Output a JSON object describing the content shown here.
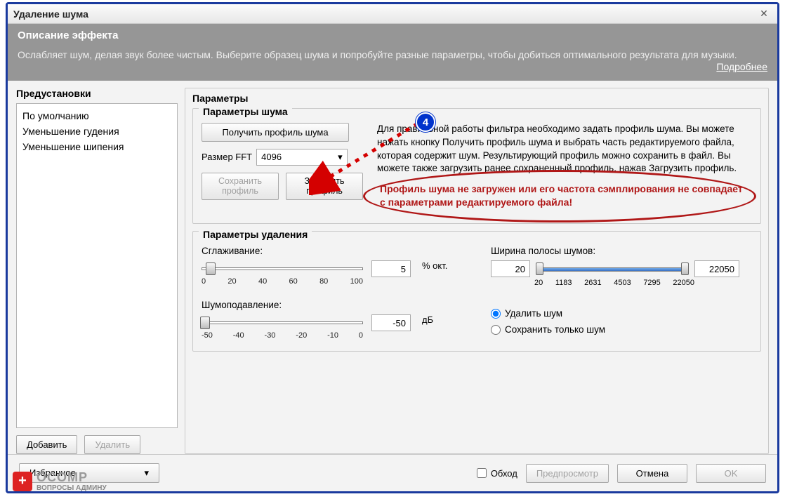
{
  "dialog": {
    "title": "Удаление шума",
    "close_icon": "✕"
  },
  "effect": {
    "header": "Описание эффекта",
    "body": "Ослабляет шум, делая звук более чистым. Выберите образец шума и попробуйте разные параметры, чтобы добиться оптимального результата для музыки.",
    "more": "Подробнее"
  },
  "presets": {
    "title": "Предустановки",
    "items": [
      "По умолчанию",
      "Уменьшение гудения",
      "Уменьшение шипения"
    ],
    "add": "Добавить",
    "remove": "Удалить"
  },
  "params": {
    "title": "Параметры",
    "noise": {
      "title": "Параметры шума",
      "get_profile": "Получить профиль шума",
      "fft_label": "Размер FFT",
      "fft_value": "4096",
      "save_profile": "Сохранить\nпрофиль",
      "load_profile": "Загрузить\nпрофиль",
      "help": "Для правильной работы фильтра необходимо задать профиль шума. Вы можете нажать кнопку Получить профиль шума и выбрать часть редактируемого файла, которая содержит шум. Результирующий профиль можно сохранить в файл. Вы можете также загрузить ранее сохраненный профиль, нажав Загрузить профиль.",
      "error": "Профиль шума не загружен или его частота сэмплирования не совпадает с параметрами редактируемого файла!"
    },
    "removal": {
      "title": "Параметры удаления",
      "smoothing_label": "Сглаживание:",
      "smoothing_value": "5",
      "smoothing_unit": "% окт.",
      "smoothing_ticks": [
        "0",
        "20",
        "40",
        "60",
        "80",
        "100"
      ],
      "reduction_label": "Шумоподавление:",
      "reduction_value": "-50",
      "reduction_unit": "дБ",
      "reduction_ticks": [
        "-50",
        "-40",
        "-30",
        "-20",
        "-10",
        "0"
      ],
      "band_label": "Ширина полосы шумов:",
      "band_low": "20",
      "band_high": "22050",
      "band_ticks": [
        "20",
        "1183",
        "2631",
        "4503",
        "7295",
        "22050"
      ],
      "radio_remove": "Удалить шум",
      "radio_keep": "Сохранить только шум"
    }
  },
  "footer": {
    "select_all": "Избранное",
    "bypass": "Обход",
    "preview": "Предпросмотр",
    "cancel": "Отмена",
    "ok": "OK"
  },
  "annotation": {
    "badge": "4"
  },
  "watermark": {
    "brand": "OCOMP",
    "tag": "ВОПРОСЫ АДМИНУ"
  }
}
